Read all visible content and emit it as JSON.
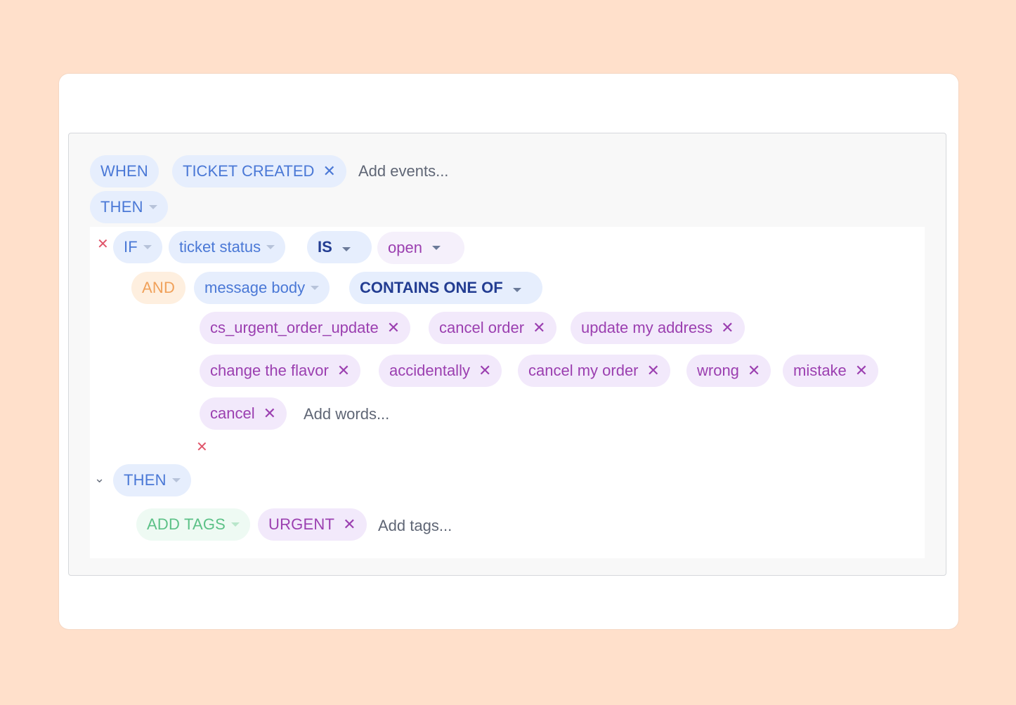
{
  "trigger": {
    "when_label": "WHEN",
    "event": "TICKET CREATED",
    "add_events_placeholder": "Add events...",
    "then_label": "THEN"
  },
  "condition": {
    "if_label": "IF",
    "field": "ticket status",
    "operator": "IS",
    "value": "open",
    "and_label": "AND",
    "field2": "message body",
    "operator2": "CONTAINS ONE OF",
    "words": [
      "cs_urgent_order_update",
      "cancel order",
      "update my address",
      "change the flavor",
      "accidentally",
      "cancel my order",
      "wrong",
      "mistake",
      "cancel"
    ],
    "add_words_placeholder": "Add words..."
  },
  "action": {
    "then_label": "THEN",
    "action_label": "ADD TAGS",
    "tag": "URGENT",
    "add_tags_placeholder": "Add tags..."
  },
  "icons": {
    "remove": "close-icon",
    "dropdown": "caret-down-icon",
    "collapse": "chevron-down-icon"
  },
  "colors": {
    "background": "#FFE0CB",
    "keyword_blue": "#4A78D6",
    "value_purple": "#9B3FB0",
    "and_orange": "#F0A15A",
    "action_green": "#5CC187",
    "delete_red": "#E0556A"
  }
}
